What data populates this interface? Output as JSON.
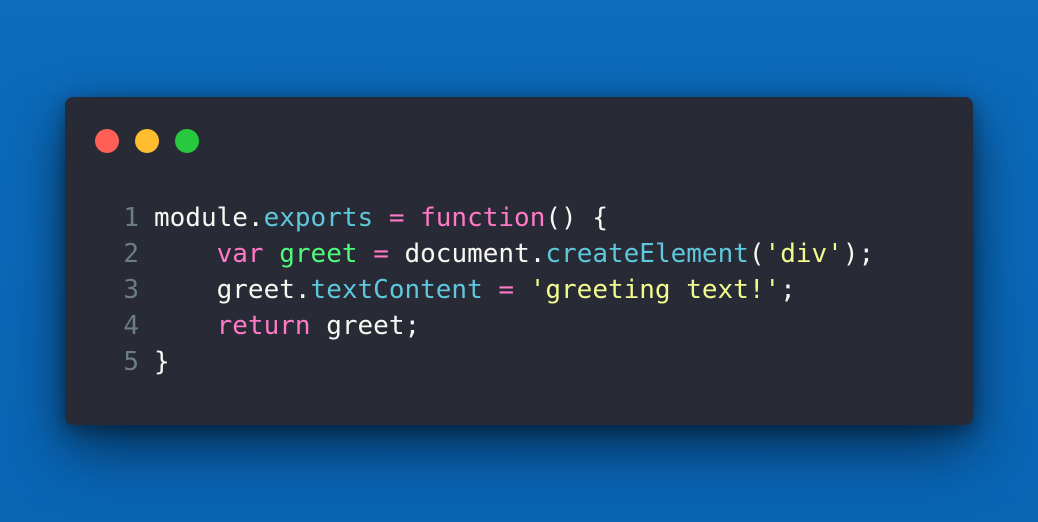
{
  "window": {
    "buttons": [
      {
        "name": "close",
        "color": "#ff5f56"
      },
      {
        "name": "minimize",
        "color": "#ffbd2e"
      },
      {
        "name": "maximize",
        "color": "#27c93f"
      }
    ]
  },
  "code": {
    "lines": [
      {
        "number": "1",
        "tokens": [
          {
            "text": "module",
            "type": "plain"
          },
          {
            "text": ".",
            "type": "plain"
          },
          {
            "text": "exports",
            "type": "prop"
          },
          {
            "text": " ",
            "type": "plain"
          },
          {
            "text": "=",
            "type": "op"
          },
          {
            "text": " ",
            "type": "plain"
          },
          {
            "text": "function",
            "type": "kw"
          },
          {
            "text": "() {",
            "type": "plain"
          }
        ]
      },
      {
        "number": "2",
        "tokens": [
          {
            "text": "    ",
            "type": "plain"
          },
          {
            "text": "var",
            "type": "kw"
          },
          {
            "text": " ",
            "type": "plain"
          },
          {
            "text": "greet",
            "type": "var"
          },
          {
            "text": " ",
            "type": "plain"
          },
          {
            "text": "=",
            "type": "op"
          },
          {
            "text": " document.",
            "type": "plain"
          },
          {
            "text": "createElement",
            "type": "prop"
          },
          {
            "text": "(",
            "type": "plain"
          },
          {
            "text": "'div'",
            "type": "str"
          },
          {
            "text": ");",
            "type": "plain"
          }
        ]
      },
      {
        "number": "3",
        "tokens": [
          {
            "text": "    greet.",
            "type": "plain"
          },
          {
            "text": "textContent",
            "type": "prop"
          },
          {
            "text": " ",
            "type": "plain"
          },
          {
            "text": "=",
            "type": "op"
          },
          {
            "text": " ",
            "type": "plain"
          },
          {
            "text": "'greeting text!'",
            "type": "str"
          },
          {
            "text": ";",
            "type": "plain"
          }
        ]
      },
      {
        "number": "4",
        "tokens": [
          {
            "text": "    ",
            "type": "plain"
          },
          {
            "text": "return",
            "type": "kw"
          },
          {
            "text": " greet;",
            "type": "plain"
          }
        ]
      },
      {
        "number": "5",
        "tokens": [
          {
            "text": "}",
            "type": "plain"
          }
        ]
      }
    ]
  },
  "colors": {
    "background": "#0a68b8",
    "window": "#282a36",
    "keyword": "#ff79c6",
    "property": "#5fc7dc",
    "string": "#f1fa8c",
    "variable": "#50fa7b",
    "text": "#f8f8f2",
    "line_number": "#6c7c84"
  }
}
